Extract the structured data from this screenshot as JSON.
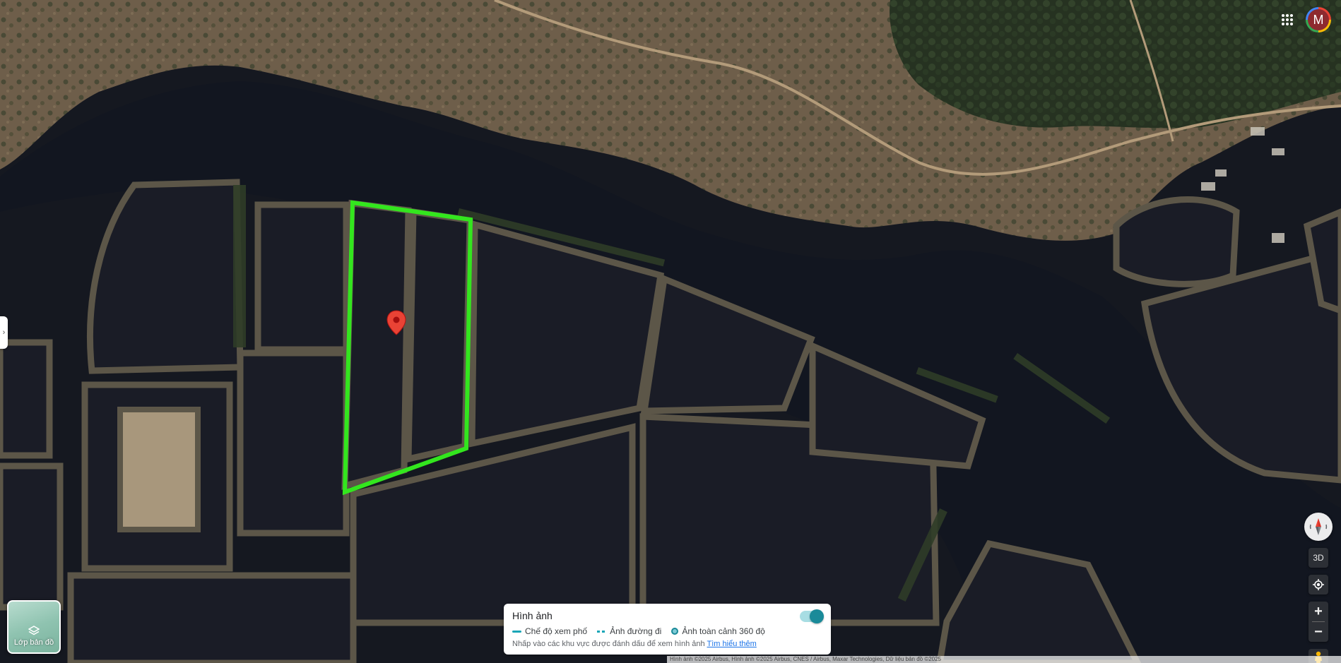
{
  "app": {
    "map_type": "satellite",
    "account_initial": "M"
  },
  "colors": {
    "water": "#151820",
    "land": "#6e5e4a",
    "vegetation": "#2f3d28",
    "selection_outline": "#33e61e",
    "marker": "#ea4335",
    "accent": "#1a8a99"
  },
  "icons": {
    "apps": "apps-grid-icon",
    "layers": "layers-icon",
    "compass": "compass-icon",
    "location": "my-location-icon",
    "pegman": "pegman-icon",
    "zoom_in": "plus-icon",
    "zoom_out": "minus-icon"
  },
  "controls": {
    "layer_button_label": "Lớp bản đồ",
    "tilt_label": "3D",
    "zoom_in_label": "+",
    "zoom_out_label": "−",
    "side_toggle_label": "›"
  },
  "legend": {
    "title": "Hình ảnh",
    "items": [
      {
        "label": "Chế độ xem phố"
      },
      {
        "label": "Ảnh đường đi"
      },
      {
        "label": "Ảnh toàn cảnh 360 độ"
      }
    ],
    "hint": "Nhấp vào các khu vực được đánh dấu để xem hình ảnh",
    "learn_more": "Tìm hiểu thêm",
    "toggle_on": true
  },
  "attribution": {
    "text": "Hình ảnh ©2025 Airbus, Hình ảnh ©2025 Airbus, CNES / Airbus, Maxar Technologies, Dữ liệu bản đồ ©2025"
  }
}
